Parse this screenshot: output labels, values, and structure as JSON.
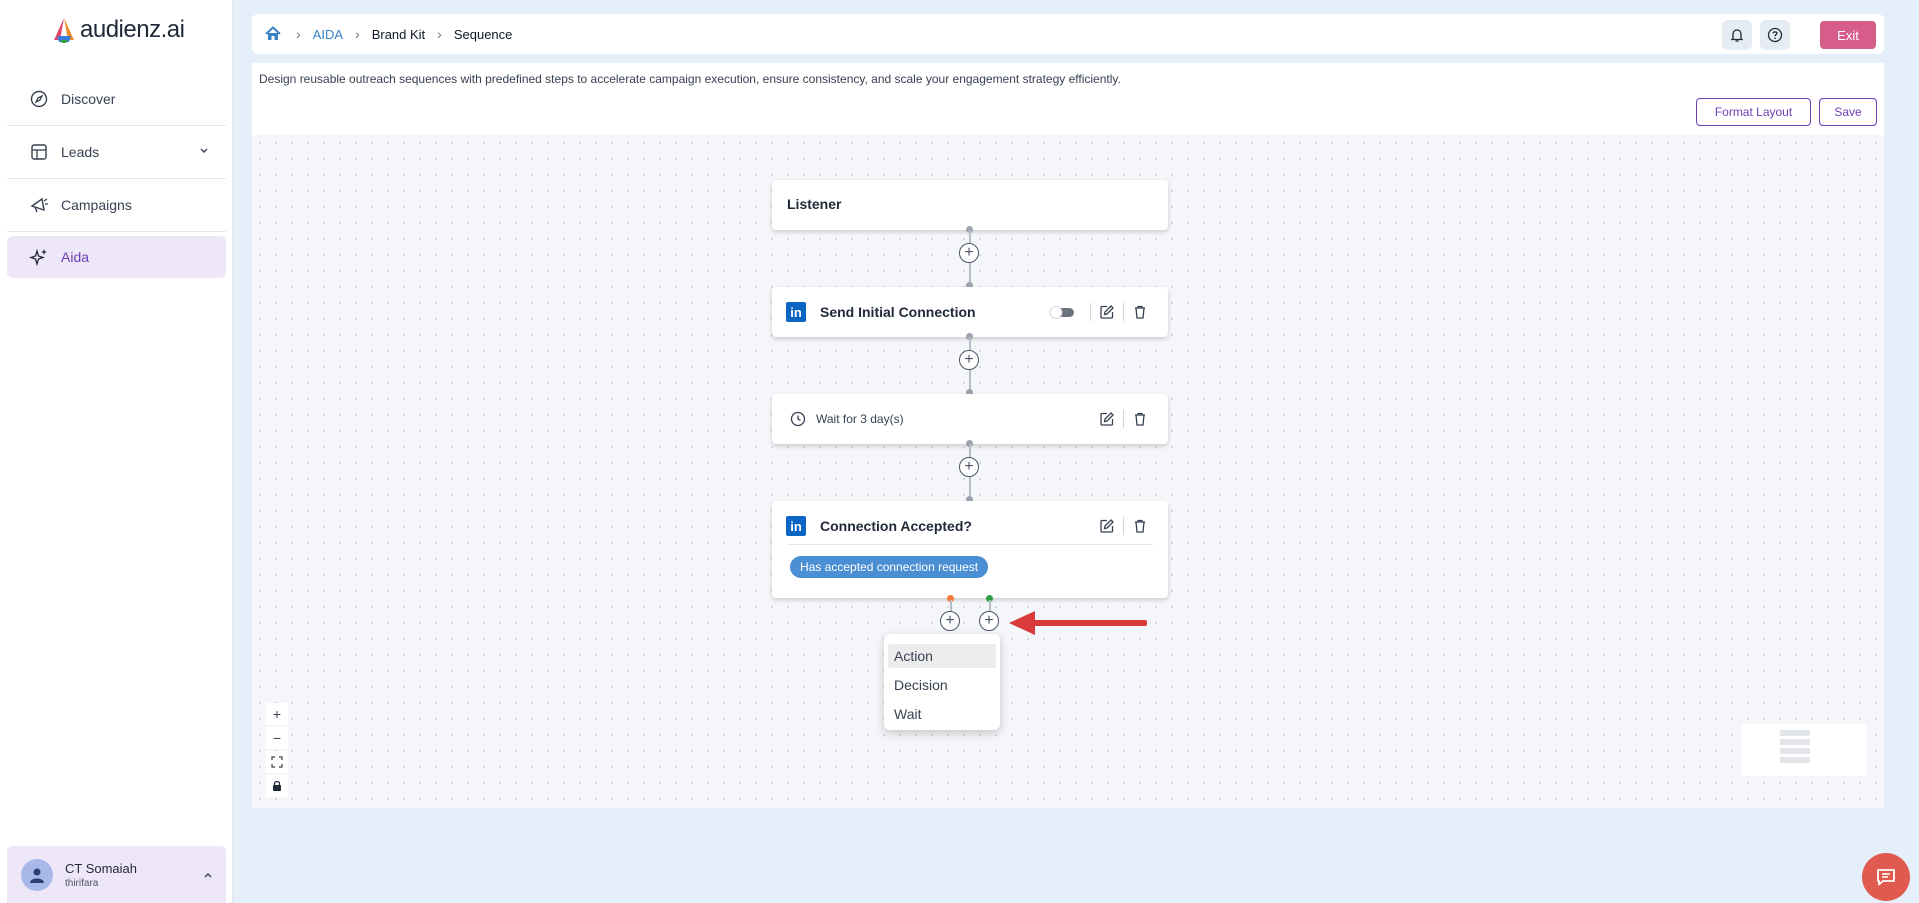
{
  "brand": {
    "name": "audienz.ai"
  },
  "sidebar": {
    "items": [
      {
        "label": "Discover",
        "icon": "compass-icon"
      },
      {
        "label": "Leads",
        "icon": "table-icon"
      },
      {
        "label": "Campaigns",
        "icon": "megaphone-icon"
      },
      {
        "label": "Aida",
        "icon": "sparkles-icon",
        "active": true
      }
    ],
    "user": {
      "name": "CT Somaiah",
      "org": "thirifara"
    }
  },
  "breadcrumb": {
    "items": [
      "AIDA",
      "Brand Kit",
      "Sequence"
    ]
  },
  "header": {
    "exit_label": "Exit"
  },
  "page": {
    "description": "Design reusable outreach sequences with predefined steps to accelerate campaign execution, ensure consistency, and scale your engagement strategy efficiently.",
    "format_layout_label": "Format Layout",
    "save_label": "Save"
  },
  "flow": {
    "listener": {
      "title": "Listener"
    },
    "send_connection": {
      "title": "Send Initial Connection",
      "toggle_on": false
    },
    "wait": {
      "title": "Wait for 3 day(s)"
    },
    "decision": {
      "title": "Connection Accepted?",
      "condition": "Has accepted connection request"
    }
  },
  "add_menu": {
    "items": [
      "Action",
      "Decision",
      "Wait"
    ],
    "highlighted": "Action"
  },
  "zoom_controls": {
    "zoom_in": "+",
    "zoom_out": "−"
  },
  "colors": {
    "accent": "#6d3fb5",
    "exit": "#d65c8a",
    "linkedin": "#0a66c2",
    "badge": "#4a8fd4",
    "no_branch": "#f47a3c",
    "yes_branch": "#2f9e44",
    "arrow": "#d93a3a"
  }
}
